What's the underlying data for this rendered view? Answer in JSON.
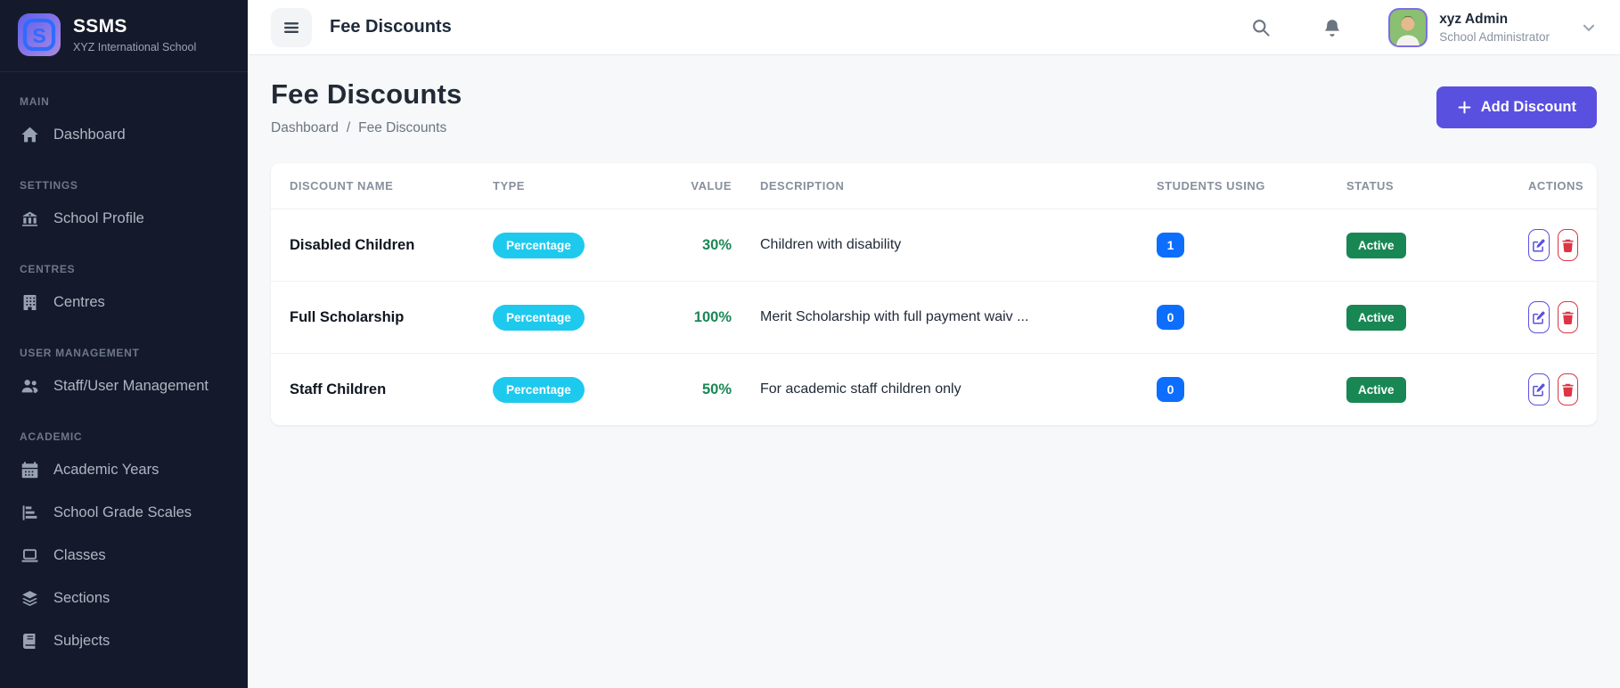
{
  "brand": {
    "name": "SSMS",
    "subtitle": "XYZ International School"
  },
  "sidebar": {
    "sections": [
      {
        "label": "MAIN",
        "items": [
          {
            "label": "Dashboard",
            "icon": "home-icon"
          }
        ]
      },
      {
        "label": "SETTINGS",
        "items": [
          {
            "label": "School Profile",
            "icon": "school-icon"
          }
        ]
      },
      {
        "label": "CENTRES",
        "items": [
          {
            "label": "Centres",
            "icon": "building-icon"
          }
        ]
      },
      {
        "label": "USER MANAGEMENT",
        "items": [
          {
            "label": "Staff/User Management",
            "icon": "users-icon"
          }
        ]
      },
      {
        "label": "ACADEMIC",
        "items": [
          {
            "label": "Academic Years",
            "icon": "calendar-icon"
          },
          {
            "label": "School Grade Scales",
            "icon": "grade-scales-icon"
          },
          {
            "label": "Classes",
            "icon": "laptop-icon"
          },
          {
            "label": "Sections",
            "icon": "layers-icon"
          },
          {
            "label": "Subjects",
            "icon": "book-icon"
          }
        ]
      }
    ]
  },
  "header": {
    "title": "Fee Discounts",
    "user": {
      "name": "xyz Admin",
      "role": "School Administrator"
    }
  },
  "page": {
    "title": "Fee Discounts",
    "breadcrumb": {
      "parent": "Dashboard",
      "separator": "/",
      "current": "Fee Discounts"
    },
    "add_button_label": "Add Discount"
  },
  "table": {
    "columns": [
      "DISCOUNT NAME",
      "TYPE",
      "VALUE",
      "DESCRIPTION",
      "STUDENTS USING",
      "STATUS",
      "ACTIONS"
    ],
    "rows": [
      {
        "name": "Disabled Children",
        "type": "Percentage",
        "value": "30%",
        "description": "Children with disability",
        "students_using": "1",
        "status": "Active"
      },
      {
        "name": "Full Scholarship",
        "type": "Percentage",
        "value": "100%",
        "description": "Merit Scholarship with full payment waiv ...",
        "students_using": "0",
        "status": "Active"
      },
      {
        "name": "Staff Children",
        "type": "Percentage",
        "value": "50%",
        "description": "For academic staff children only",
        "students_using": "0",
        "status": "Active"
      }
    ]
  },
  "colors": {
    "sidebar_bg": "#141a2b",
    "accent": "#5a50e0",
    "type_badge": "#1ec9ee",
    "count_badge": "#0d6efd",
    "success": "#198754",
    "danger": "#dc3545"
  }
}
